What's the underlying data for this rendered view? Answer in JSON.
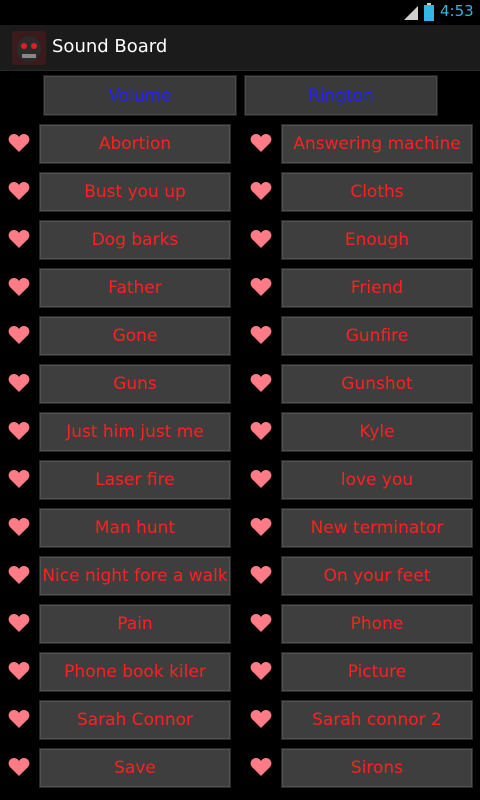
{
  "status": {
    "time": "4:53",
    "signal": "3G"
  },
  "app": {
    "title": "Sound Board"
  },
  "top_buttons": {
    "volume": "Volume",
    "rington": "Rington"
  },
  "rows": [
    [
      "Abortion",
      "Answering machine"
    ],
    [
      "Bust you up",
      "Cloths"
    ],
    [
      "Dog barks",
      "Enough"
    ],
    [
      "Father",
      "Friend"
    ],
    [
      "Gone",
      "Gunfire"
    ],
    [
      "Guns",
      "Gunshot"
    ],
    [
      "Just him just me",
      "Kyle"
    ],
    [
      "Laser fire",
      "love you"
    ],
    [
      "Man hunt",
      "New terminator"
    ],
    [
      "Nice night fore a walk",
      "On your feet"
    ],
    [
      "Pain",
      "Phone"
    ],
    [
      "Phone book kiler",
      "Picture"
    ],
    [
      "Sarah Connor",
      "Sarah connor 2"
    ],
    [
      "Save",
      "Sirons"
    ]
  ],
  "colors": {
    "button_text": "#ff2020",
    "top_button_text": "#2020ff",
    "heart": "#ff7b86",
    "clock": "#33b5e5"
  },
  "icons": {
    "favorite": "heart-icon"
  }
}
